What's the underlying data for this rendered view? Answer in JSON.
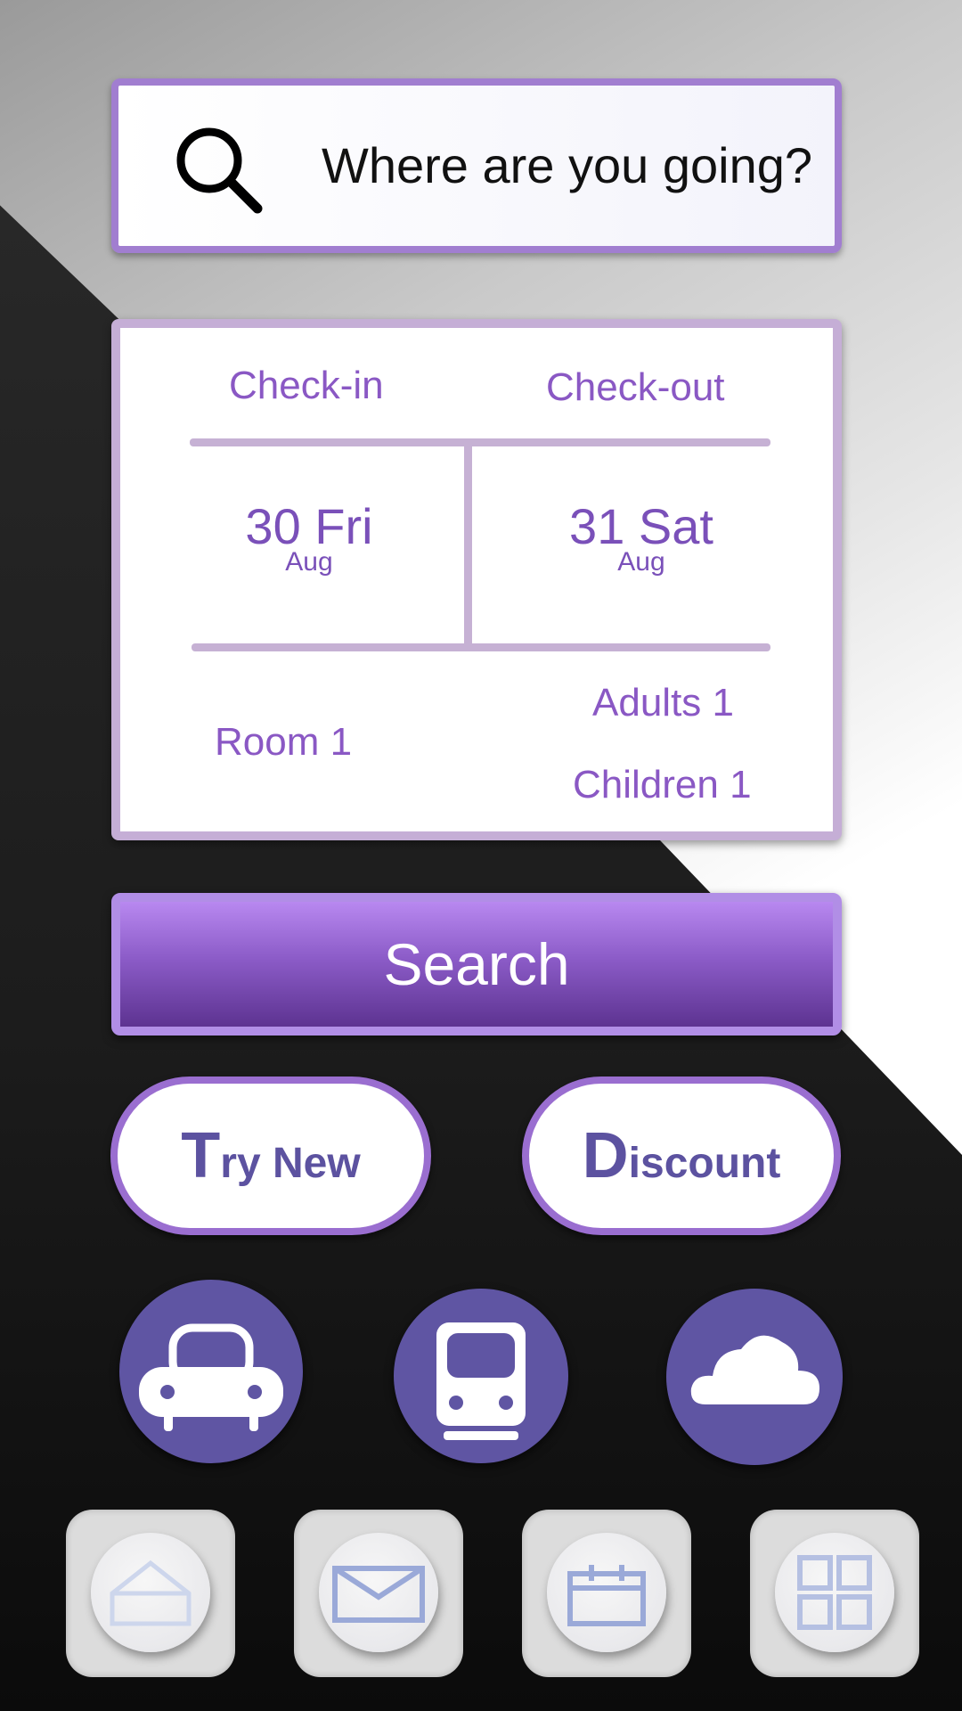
{
  "search": {
    "prompt": "Where are you going?",
    "icon": "search-icon"
  },
  "booking": {
    "checkin_label": "Check-in",
    "checkout_label": "Check-out",
    "checkin_day": "30 Fri",
    "checkin_month": "Aug",
    "checkout_day": "31 Sat",
    "checkout_month": "Aug",
    "room": "Room 1",
    "adults": "Adults 1",
    "children": "Children 1"
  },
  "actions": {
    "search_label": "Search",
    "try_new_cap": "T",
    "try_new_rest": "ry New",
    "discount_cap": "D",
    "discount_rest": "iscount"
  },
  "categories": [
    {
      "icon": "car-icon"
    },
    {
      "icon": "train-icon"
    },
    {
      "icon": "cloud-icon"
    }
  ],
  "dock": [
    {
      "icon": "home-icon"
    },
    {
      "icon": "mail-icon"
    },
    {
      "icon": "calendar-icon"
    },
    {
      "icon": "grid-icon"
    }
  ],
  "colors": {
    "accent": "#8a58c4",
    "button_purple": "#7a4cb8",
    "icon_circle": "#5f55a3"
  }
}
